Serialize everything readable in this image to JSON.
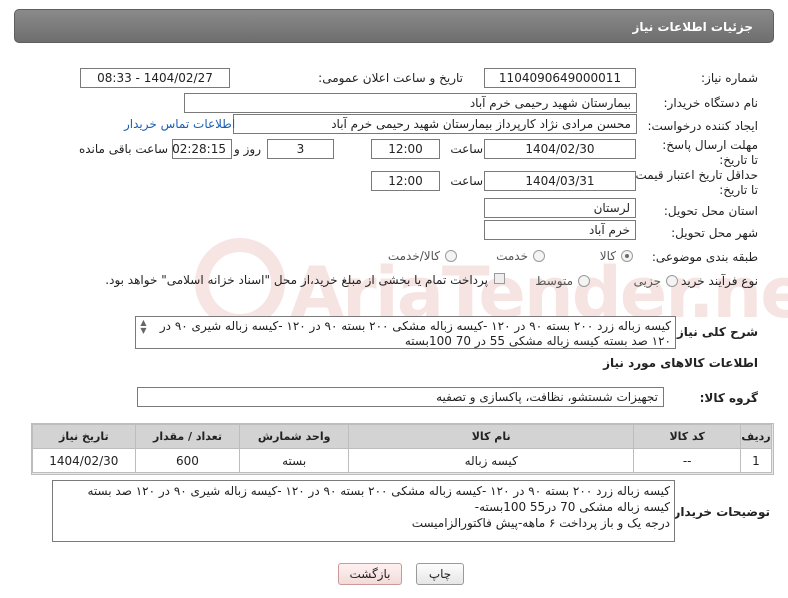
{
  "header": {
    "title": "جزئیات اطلاعات نیاز"
  },
  "watermark": {
    "text": "AriaTender.neT"
  },
  "fields": {
    "need_number_label": "شماره نیاز:",
    "need_number": "1104090649000011",
    "announce_label": "تاریخ و ساعت اعلان عمومی:",
    "announce_value": "1404/02/27 - 08:33",
    "buyer_org_label": "نام دستگاه خریدار:",
    "buyer_org": "بیمارستان شهید رحیمی خرم آباد",
    "creator_label": "ایجاد کننده درخواست:",
    "creator": "محسن مرادی نژاد کارپرداز بیمارستان شهید رحیمی خرم آباد",
    "contact_link": "اطلاعات تماس خریدار",
    "deadline_label": "مهلت ارسال پاسخ: تا تاریخ:",
    "deadline_date": "1404/02/30",
    "time_label": "ساعت",
    "deadline_time": "12:00",
    "days_value": "3",
    "days_label": "روز و",
    "remaining_time": "02:28:15",
    "remaining_label": "ساعت باقی مانده",
    "min_validity_label": "حداقل تاریخ اعتبار قیمت:",
    "min_validity_to_label": "تا تاریخ:",
    "validity_date": "1404/03/31",
    "validity_time": "12:00",
    "province_label": "استان محل تحویل:",
    "province": "لرستان",
    "city_label": "شهر محل تحویل:",
    "city": "خرم آباد",
    "category_label": "طبقه بندی موضوعی:",
    "category_options": [
      "کالا",
      "خدمت",
      "کالا/خدمت"
    ],
    "process_label": "نوع فرآیند خرید :",
    "process_options": [
      "جزیی",
      "متوسط"
    ],
    "payment_note": "پرداخت تمام یا بخشی از مبلغ خرید،از محل \"اسناد خزانه اسلامی\" خواهد بود."
  },
  "description": {
    "label": "شرح کلی نیاز:",
    "text": "کیسه زباله زرد ۲۰۰ بسته ۹۰ در ۱۲۰ -کیسه زباله مشکی ۲۰۰ بسته ۹۰ در ۱۲۰ -کیسه زباله شیری ۹۰ در ۱۲۰ صد بسته کیسه زباله مشکی 55 در 70   100بسته"
  },
  "goods_info": {
    "title": "اطلاعات کالاهای مورد نیاز",
    "group_label": "گروه کالا:",
    "group_value": "تجهیزات شستشو، نظافت، پاکسازی و تصفیه"
  },
  "table": {
    "headers": [
      "ردیف",
      "کد کالا",
      "نام کالا",
      "واحد شمارش",
      "تعداد / مقدار",
      "تاریخ نیاز"
    ],
    "rows": [
      [
        "1",
        "--",
        "کیسه زباله",
        "بسته",
        "600",
        "1404/02/30"
      ]
    ]
  },
  "buyer_notes": {
    "label": "توضیحات خریدار:",
    "lines": [
      "کیسه زباله زرد ۲۰۰ بسته ۹۰ در ۱۲۰ -کیسه زباله مشکی ۲۰۰ بسته ۹۰ در ۱۲۰ -کیسه زباله شیری ۹۰ در ۱۲۰  صد بسته",
      "کیسه زباله مشکی 70 در55  100بسته-",
      "درجه یک و باز پرداخت ۶ ماهه-پیش فاکتورالزامیست"
    ]
  },
  "buttons": {
    "print": "چاپ",
    "back": "بازگشت"
  },
  "colors": {
    "header": "#7a7a7a",
    "link": "#1a5fb4",
    "table_header": "#d3d3d3",
    "back_button": "#f2dada"
  }
}
